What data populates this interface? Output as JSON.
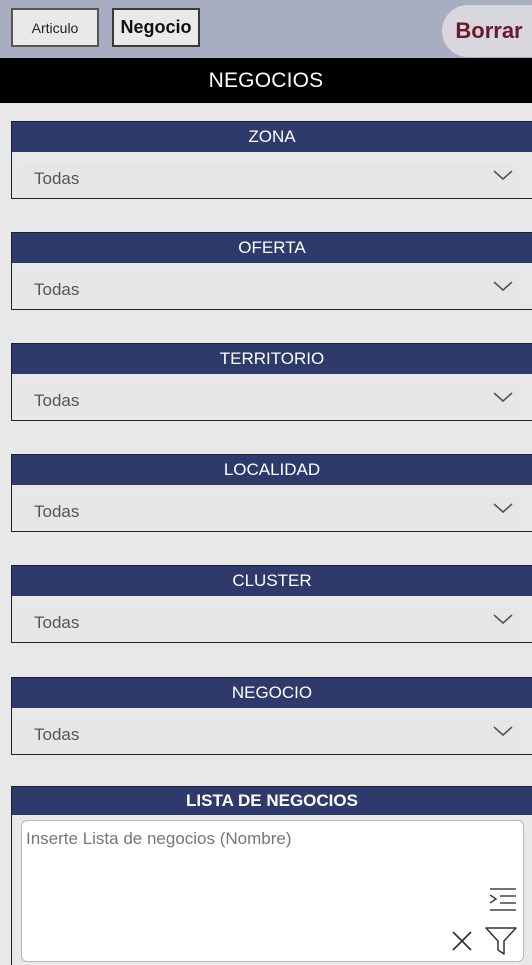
{
  "header": {
    "tab_articulo": "Articulo",
    "tab_negocio": "Negocio",
    "borrar_label": "Borrar"
  },
  "title": "NEGOCIOS",
  "filters": [
    {
      "label": "ZONA",
      "value": "Todas"
    },
    {
      "label": "OFERTA",
      "value": "Todas"
    },
    {
      "label": "TERRITORIO",
      "value": "Todas"
    },
    {
      "label": "LOCALIDAD",
      "value": "Todas"
    },
    {
      "label": "CLUSTER",
      "value": "Todas"
    },
    {
      "label": "NEGOCIO",
      "value": "Todas"
    }
  ],
  "lista": {
    "label": "LISTA DE NEGOCIOS",
    "placeholder": "Inserte Lista de negocios (Nombre)",
    "value": ""
  },
  "colors": {
    "topbar": "#a9adc2",
    "header_blue": "#2d3a6b",
    "borrar_text": "#6a1a2a"
  },
  "icons": [
    "chevron-down-icon",
    "indent-list-icon",
    "close-icon",
    "filter-icon"
  ]
}
